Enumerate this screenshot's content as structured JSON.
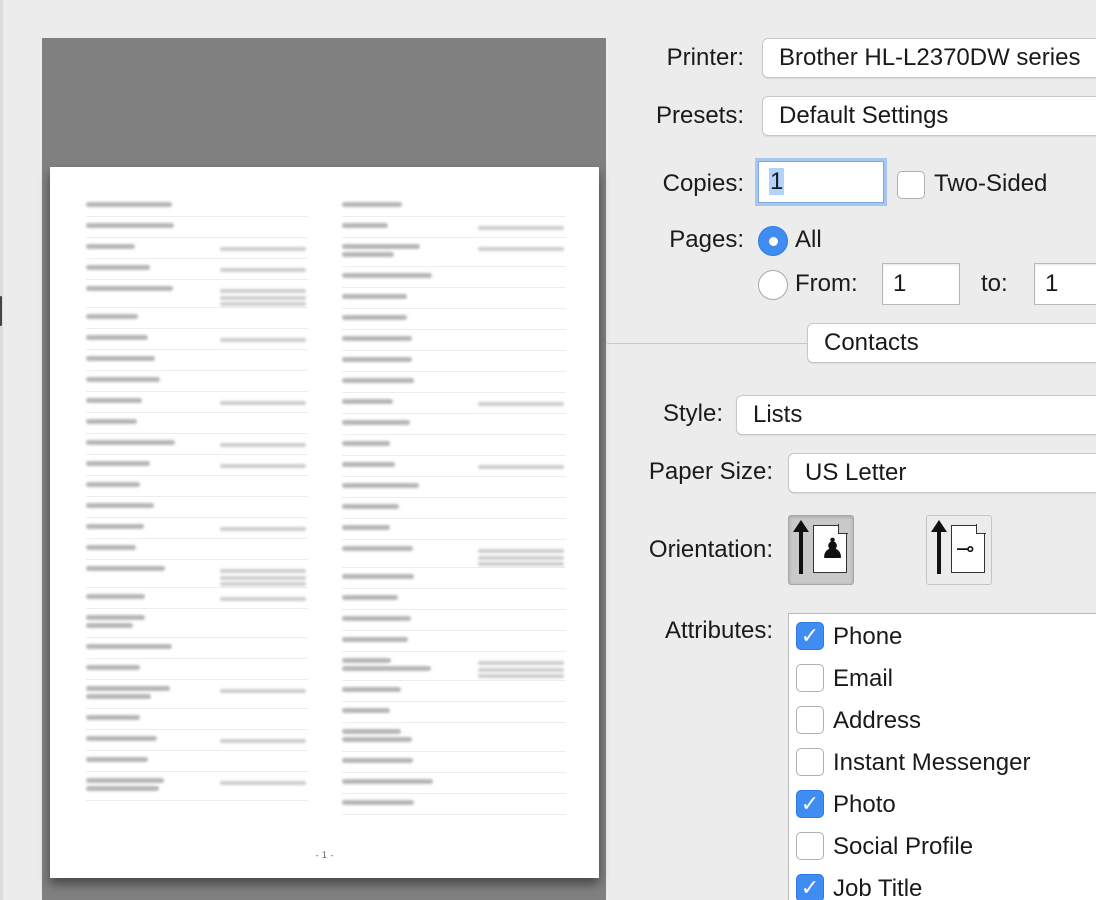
{
  "preview": {
    "page_number": "- 1 -",
    "left_contacts": [
      {
        "lines": 1,
        "phones": 0
      },
      {
        "lines": 1,
        "phones": 0
      },
      {
        "lines": 1,
        "phones": 1
      },
      {
        "lines": 1,
        "phones": 1
      },
      {
        "lines": 1,
        "phones": 3
      },
      {
        "lines": 1,
        "phones": 0
      },
      {
        "lines": 1,
        "phones": 1
      },
      {
        "lines": 1,
        "phones": 0
      },
      {
        "lines": 1,
        "phones": 0
      },
      {
        "lines": 1,
        "phones": 1
      },
      {
        "lines": 1,
        "phones": 0
      },
      {
        "lines": 1,
        "phones": 1
      },
      {
        "lines": 1,
        "phones": 1
      },
      {
        "lines": 1,
        "phones": 0
      },
      {
        "lines": 1,
        "phones": 0
      },
      {
        "lines": 1,
        "phones": 1
      },
      {
        "lines": 1,
        "phones": 0
      },
      {
        "lines": 1,
        "phones": 3
      },
      {
        "lines": 1,
        "phones": 1
      },
      {
        "lines": 2,
        "phones": 0
      },
      {
        "lines": 1,
        "phones": 0
      },
      {
        "lines": 1,
        "phones": 0
      },
      {
        "lines": 2,
        "phones": 1
      },
      {
        "lines": 1,
        "phones": 0
      },
      {
        "lines": 1,
        "phones": 1
      },
      {
        "lines": 1,
        "phones": 0
      },
      {
        "lines": 2,
        "phones": 1
      }
    ],
    "right_contacts": [
      {
        "lines": 1,
        "phones": 0
      },
      {
        "lines": 1,
        "phones": 1
      },
      {
        "lines": 2,
        "phones": 1
      },
      {
        "lines": 1,
        "phones": 0
      },
      {
        "lines": 1,
        "phones": 0
      },
      {
        "lines": 1,
        "phones": 0
      },
      {
        "lines": 1,
        "phones": 0
      },
      {
        "lines": 1,
        "phones": 0
      },
      {
        "lines": 1,
        "phones": 0
      },
      {
        "lines": 1,
        "phones": 1
      },
      {
        "lines": 1,
        "phones": 0
      },
      {
        "lines": 1,
        "phones": 0
      },
      {
        "lines": 1,
        "phones": 1
      },
      {
        "lines": 1,
        "phones": 0
      },
      {
        "lines": 1,
        "phones": 0
      },
      {
        "lines": 1,
        "phones": 0
      },
      {
        "lines": 1,
        "phones": 3
      },
      {
        "lines": 1,
        "phones": 0
      },
      {
        "lines": 1,
        "phones": 0
      },
      {
        "lines": 1,
        "phones": 0
      },
      {
        "lines": 1,
        "phones": 0
      },
      {
        "lines": 2,
        "phones": 3
      },
      {
        "lines": 1,
        "phones": 0
      },
      {
        "lines": 1,
        "phones": 0
      },
      {
        "lines": 2,
        "phones": 0
      },
      {
        "lines": 1,
        "phones": 0
      },
      {
        "lines": 1,
        "phones": 0
      },
      {
        "lines": 1,
        "phones": 0
      }
    ]
  },
  "printer": {
    "label": "Printer:",
    "value": "Brother HL-L2370DW series"
  },
  "presets": {
    "label": "Presets:",
    "value": "Default Settings"
  },
  "copies": {
    "label": "Copies:",
    "value": "1",
    "two_sided_label": "Two-Sided",
    "two_sided_checked": false
  },
  "pages": {
    "label": "Pages:",
    "all_label": "All",
    "all_selected": true,
    "from_label": "From:",
    "from_value": "1",
    "to_label": "to:",
    "to_value": "1"
  },
  "section_popup": {
    "value": "Contacts"
  },
  "style": {
    "label": "Style:",
    "value": "Lists"
  },
  "paper_size": {
    "label": "Paper Size:",
    "value": "US Letter"
  },
  "orientation": {
    "label": "Orientation:",
    "selected": "portrait",
    "options": [
      "portrait",
      "landscape"
    ]
  },
  "attributes": {
    "label": "Attributes:",
    "items": [
      {
        "label": "Phone",
        "checked": true
      },
      {
        "label": "Email",
        "checked": false
      },
      {
        "label": "Address",
        "checked": false
      },
      {
        "label": "Instant Messenger",
        "checked": false
      },
      {
        "label": "Photo",
        "checked": true
      },
      {
        "label": "Social Profile",
        "checked": false
      },
      {
        "label": "Job Title",
        "checked": true
      }
    ]
  },
  "colors": {
    "accent": "#3f8cf2",
    "preview_bg": "#808080",
    "window_bg": "#ececec"
  }
}
